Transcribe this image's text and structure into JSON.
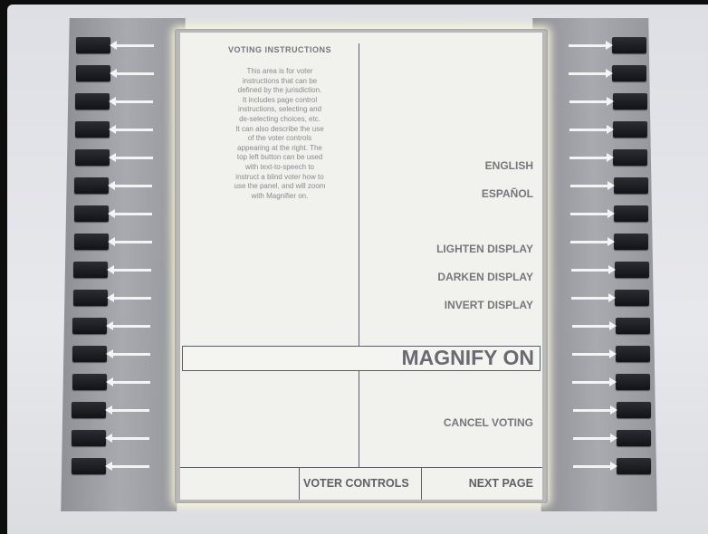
{
  "instructions": {
    "title": "VOTING INSTRUCTIONS",
    "body_lines": [
      "This area is for voter",
      "instructions that can be",
      "defined by the jurisdiction.",
      "It includes page control",
      "instructions, selecting and",
      "de-selecting choices, etc.",
      "It can also describe the use",
      "of the voter controls",
      "appearing at the right.  The",
      "top left button can be used",
      "with text-to-speech to",
      "instruct a blind voter how to",
      "use the panel, and will zoom",
      "with Magnifier on."
    ]
  },
  "options": {
    "english": "ENGLISH",
    "espanol": "ESPAÑOL",
    "lighten": "LIGHTEN DISPLAY",
    "darken": "DARKEN DISPLAY",
    "invert": "INVERT DISPLAY",
    "magnify": "MAGNIFY ON",
    "cancel": "CANCEL VOTING"
  },
  "footer": {
    "voter_controls": "VOTER CONTROLS",
    "next_page": "NEXT PAGE"
  },
  "hardware": {
    "left_button_count": 16,
    "right_button_count": 16
  },
  "colors": {
    "screen_background": "#f1f1ee",
    "button_black": "#16171a",
    "panel_grey": "#a0a2a7",
    "text_grey": "#6e6e72"
  }
}
